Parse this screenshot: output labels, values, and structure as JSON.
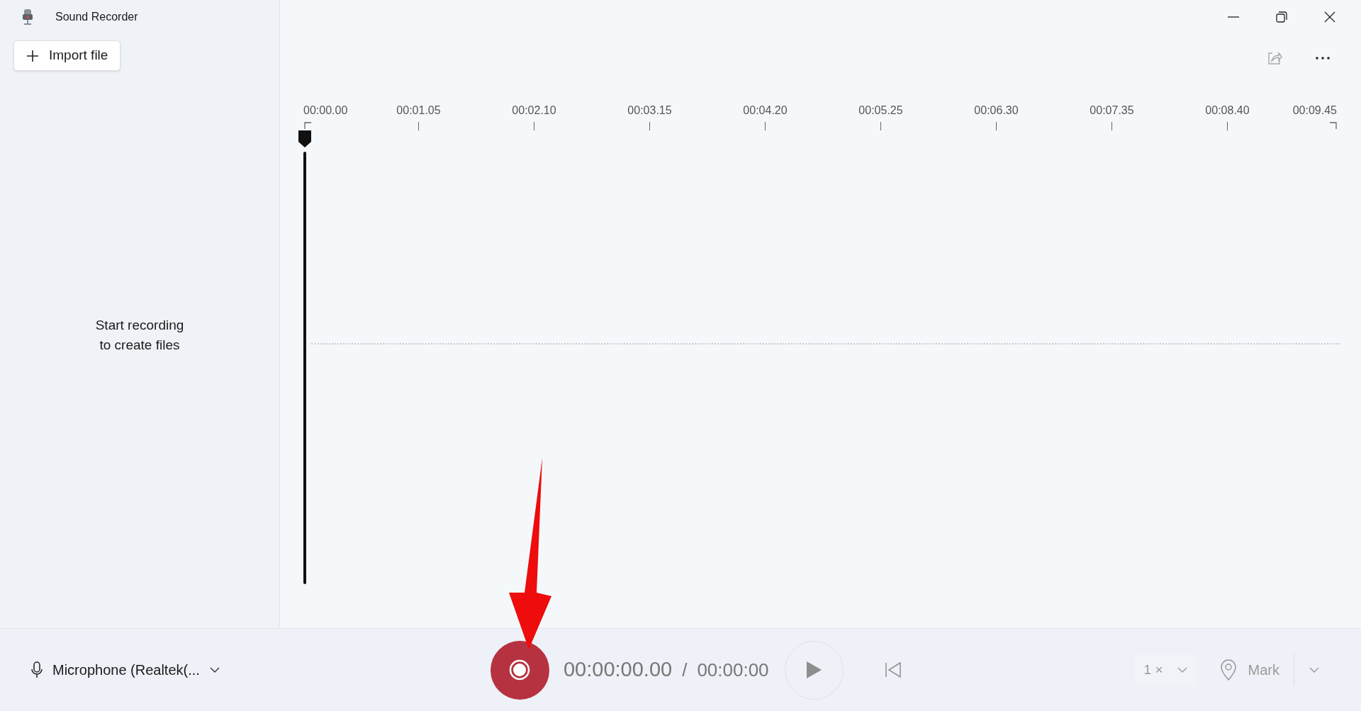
{
  "window": {
    "title": "Sound Recorder"
  },
  "sidebar": {
    "import_button": "Import file",
    "empty_message": "Start recording\nto create files"
  },
  "timeline": {
    "ticks": [
      "00:00.00",
      "00:01.05",
      "00:02.10",
      "00:03.15",
      "00:04.20",
      "00:05.25",
      "00:06.30",
      "00:07.35",
      "00:08.40",
      "00:09.45"
    ]
  },
  "bottom_bar": {
    "microphone": "Microphone (Realtek(...",
    "elapsed": "00:00:00.00",
    "separator": "/",
    "total": "00:00:00",
    "play_disabled": true,
    "restart_disabled": true,
    "speed": "1 ×",
    "speed_disabled": true,
    "mark": "Mark",
    "mark_disabled": true
  }
}
